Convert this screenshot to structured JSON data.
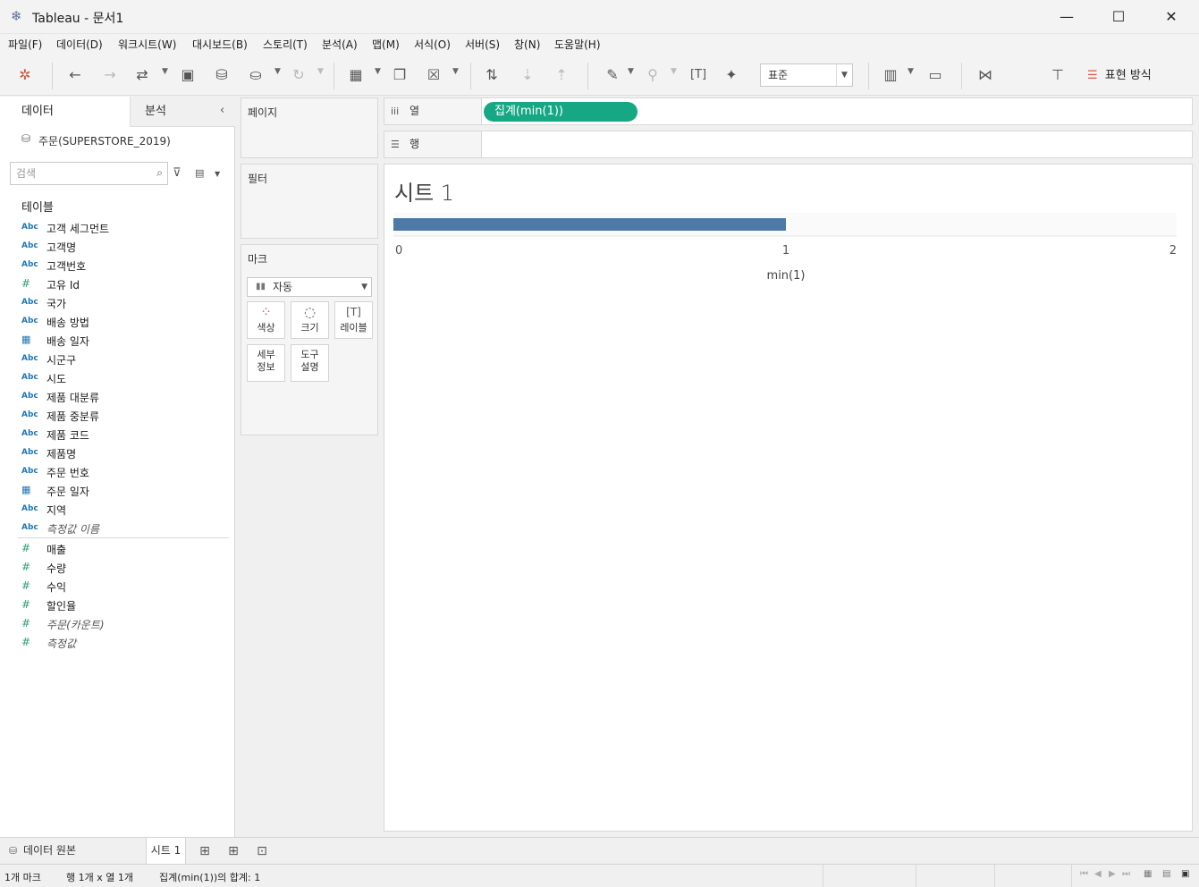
{
  "window": {
    "title": "Tableau - 문서1",
    "minimize": "—",
    "maximize": "☐",
    "close": "✕"
  },
  "menu": [
    "파일(F)",
    "데이터(D)",
    "워크시트(W)",
    "대시보드(B)",
    "스토리(T)",
    "분석(A)",
    "맵(M)",
    "서식(O)",
    "서버(S)",
    "창(N)",
    "도움말(H)"
  ],
  "toolbar": {
    "fit_value": "표준",
    "show_me_label": "표현 방식"
  },
  "datapane": {
    "tab_data": "데이터",
    "tab_analysis": "분석",
    "datasource": "주문(SUPERSTORE_2019)",
    "search_placeholder": "검색",
    "tables_heading": "테이블",
    "dimensions": [
      {
        "type": "Abc",
        "name": "고객 세그먼트"
      },
      {
        "type": "Abc",
        "name": "고객명"
      },
      {
        "type": "Abc",
        "name": "고객번호"
      },
      {
        "type": "#",
        "name": "고유 Id"
      },
      {
        "type": "Abc",
        "name": "국가"
      },
      {
        "type": "Abc",
        "name": "배송 방법"
      },
      {
        "type": "date",
        "name": "배송 일자"
      },
      {
        "type": "Abc",
        "name": "시군구"
      },
      {
        "type": "Abc",
        "name": "시도"
      },
      {
        "type": "Abc",
        "name": "제품 대분류"
      },
      {
        "type": "Abc",
        "name": "제품 중분류"
      },
      {
        "type": "Abc",
        "name": "제품 코드"
      },
      {
        "type": "Abc",
        "name": "제품명"
      },
      {
        "type": "Abc",
        "name": "주문 번호"
      },
      {
        "type": "date",
        "name": "주문 일자"
      },
      {
        "type": "Abc",
        "name": "지역"
      },
      {
        "type": "Abc",
        "name": "측정값 이름",
        "italic": true
      }
    ],
    "measures": [
      {
        "type": "#",
        "name": "매출"
      },
      {
        "type": "#",
        "name": "수량"
      },
      {
        "type": "#",
        "name": "수익"
      },
      {
        "type": "#",
        "name": "할인율"
      },
      {
        "type": "#",
        "name": "주문(카운트)",
        "italic": true
      },
      {
        "type": "#",
        "name": "측정값",
        "italic": true
      }
    ]
  },
  "cards": {
    "pages": "페이지",
    "filters": "필터",
    "marks": "마크",
    "mark_type": "자동",
    "color": "색상",
    "size": "크기",
    "label": "레이블",
    "detail_1": "세부",
    "detail_2": "정보",
    "tooltip_1": "도구",
    "tooltip_2": "설명"
  },
  "shelves": {
    "columns": "열",
    "rows": "행",
    "column_pill": "집계(min(1))"
  },
  "sheet": {
    "title": "시트 1"
  },
  "chart_data": {
    "type": "bar",
    "orientation": "horizontal",
    "categories": [
      ""
    ],
    "values": [
      1
    ],
    "xlabel": "min(1)",
    "xlim": [
      0,
      2
    ],
    "xticks": [
      "0",
      "1",
      "2"
    ],
    "bar_color": "#4e79a7"
  },
  "sheettabs": {
    "datasource": "데이터 원본",
    "sheet": "시트 1"
  },
  "status": {
    "marks": "1개 마크",
    "dims": "행 1개 x 열 1개",
    "sum": "집계(min(1))의 합계: 1"
  },
  "colors": {
    "pill": "#16a884",
    "bar": "#4e79a7"
  }
}
